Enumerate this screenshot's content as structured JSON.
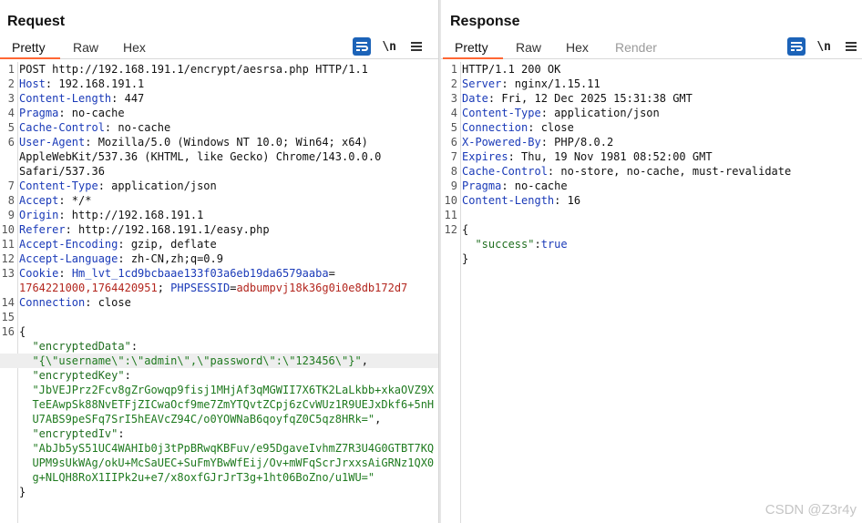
{
  "layout_switch": {
    "options": [
      "split-horizontal",
      "split-vertical",
      "single"
    ],
    "active": "split-horizontal"
  },
  "request": {
    "title": "Request",
    "tabs": [
      {
        "label": "Pretty",
        "active": true
      },
      {
        "label": "Raw"
      },
      {
        "label": "Hex"
      }
    ],
    "tools": {
      "newline_label": "\\n"
    },
    "lines": [
      {
        "n": "1",
        "parts": [
          {
            "t": "POST http://192.168.191.1/encrypt/aesrsa.php HTTP/1.1"
          }
        ]
      },
      {
        "n": "2",
        "parts": [
          {
            "t": "Host",
            "c": "k"
          },
          {
            "t": ": 192.168.191.1"
          }
        ]
      },
      {
        "n": "3",
        "parts": [
          {
            "t": "Content-Length",
            "c": "k"
          },
          {
            "t": ": 447"
          }
        ]
      },
      {
        "n": "4",
        "parts": [
          {
            "t": "Pragma",
            "c": "k"
          },
          {
            "t": ": no-cache"
          }
        ]
      },
      {
        "n": "5",
        "parts": [
          {
            "t": "Cache-Control",
            "c": "k"
          },
          {
            "t": ": no-cache"
          }
        ]
      },
      {
        "n": "6",
        "parts": [
          {
            "t": "User-Agent",
            "c": "k"
          },
          {
            "t": ": Mozilla/5.0 (Windows NT 10.0; Win64; x64)"
          }
        ]
      },
      {
        "n": "",
        "parts": [
          {
            "t": "AppleWebKit/537.36 (KHTML, like Gecko) Chrome/143.0.0.0"
          }
        ]
      },
      {
        "n": "",
        "parts": [
          {
            "t": "Safari/537.36"
          }
        ]
      },
      {
        "n": "7",
        "parts": [
          {
            "t": "Content-Type",
            "c": "k"
          },
          {
            "t": ": application/json"
          }
        ]
      },
      {
        "n": "8",
        "parts": [
          {
            "t": "Accept",
            "c": "k"
          },
          {
            "t": ": */*"
          }
        ]
      },
      {
        "n": "9",
        "parts": [
          {
            "t": "Origin",
            "c": "k"
          },
          {
            "t": ": http://192.168.191.1"
          }
        ]
      },
      {
        "n": "10",
        "parts": [
          {
            "t": "Referer",
            "c": "k"
          },
          {
            "t": ": http://192.168.191.1/easy.php"
          }
        ]
      },
      {
        "n": "11",
        "parts": [
          {
            "t": "Accept-Encoding",
            "c": "k"
          },
          {
            "t": ": gzip, deflate"
          }
        ]
      },
      {
        "n": "12",
        "parts": [
          {
            "t": "Accept-Language",
            "c": "k"
          },
          {
            "t": ": zh-CN,zh;q=0.9"
          }
        ]
      },
      {
        "n": "13",
        "parts": [
          {
            "t": "Cookie",
            "c": "k"
          },
          {
            "t": ": "
          },
          {
            "t": "Hm_lvt_1cd9bcbaae133f03a6eb19da6579aaba",
            "c": "cookie"
          },
          {
            "t": "="
          }
        ]
      },
      {
        "n": "",
        "parts": [
          {
            "t": "1764221000,1764420951",
            "c": "cval"
          },
          {
            "t": "; "
          },
          {
            "t": "PHPSESSID",
            "c": "cookie"
          },
          {
            "t": "="
          },
          {
            "t": "adbumpvj18k36g0i0e8db172d7",
            "c": "cval"
          }
        ]
      },
      {
        "n": "14",
        "parts": [
          {
            "t": "Connection",
            "c": "k"
          },
          {
            "t": ": close"
          }
        ]
      },
      {
        "n": "15",
        "parts": [
          {
            "t": ""
          }
        ]
      },
      {
        "n": "16",
        "parts": [
          {
            "t": "{"
          }
        ]
      },
      {
        "n": "",
        "parts": [
          {
            "t": "  \"encryptedData\"",
            "c": "jkey"
          },
          {
            "t": ":"
          }
        ]
      },
      {
        "n": "",
        "hl": true,
        "parts": [
          {
            "t": "  \"{\\\"username\\\":\\\"admin\\\",\\\"password\\\":\\\"123456\\\"}\"",
            "c": "jstr"
          },
          {
            "t": ","
          }
        ]
      },
      {
        "n": "",
        "parts": [
          {
            "t": "  \"encryptedKey\"",
            "c": "jkey"
          },
          {
            "t": ":"
          }
        ]
      },
      {
        "n": "",
        "parts": [
          {
            "t": "  \"JbVEJPrz2Fcv8gZrGowqp9fisj1MHjAf3qMGWII7X6TK2LaLkbb+xkaOVZ9X",
            "c": "jstr"
          }
        ]
      },
      {
        "n": "",
        "parts": [
          {
            "t": "  TeEAwpSk88NvETFjZICwaOcf9me7ZmYTQvtZCpj6zCvWUz1R9UEJxDkf6+5nH",
            "c": "jstr"
          }
        ]
      },
      {
        "n": "",
        "parts": [
          {
            "t": "  U7ABS9peSFq7SrI5hEAVcZ94C/o0YOWNaB6qoyfqZ0C5qz8HRk=\"",
            "c": "jstr"
          },
          {
            "t": ","
          }
        ]
      },
      {
        "n": "",
        "parts": [
          {
            "t": "  \"encryptedIv\"",
            "c": "jkey"
          },
          {
            "t": ":"
          }
        ]
      },
      {
        "n": "",
        "parts": [
          {
            "t": "  \"AbJb5yS51UC4WAHIb0j3tPpBRwqKBFuv/e95DgaveIvhmZ7R3U4G0GTBT7KQ",
            "c": "jstr"
          }
        ]
      },
      {
        "n": "",
        "parts": [
          {
            "t": "  UPM9sUkWAg/okU+McSaUEC+SuFmYBwWfEij/Ov+mWFqScrJrxxsAiGRNz1QX0",
            "c": "jstr"
          }
        ]
      },
      {
        "n": "",
        "parts": [
          {
            "t": "  g+NLQH8RoX1IIPk2u+e7/x8oxfGJrJrT3g+1ht06BoZno/u1WU=\"",
            "c": "jstr"
          }
        ]
      },
      {
        "n": "",
        "parts": [
          {
            "t": "}"
          }
        ]
      }
    ]
  },
  "response": {
    "title": "Response",
    "tabs": [
      {
        "label": "Pretty",
        "active": true
      },
      {
        "label": "Raw"
      },
      {
        "label": "Hex"
      },
      {
        "label": "Render",
        "disabled": true
      }
    ],
    "tools": {
      "newline_label": "\\n"
    },
    "lines": [
      {
        "n": "1",
        "parts": [
          {
            "t": "HTTP/1.1 200 OK"
          }
        ]
      },
      {
        "n": "2",
        "parts": [
          {
            "t": "Server",
            "c": "k"
          },
          {
            "t": ": nginx/1.15.11"
          }
        ]
      },
      {
        "n": "3",
        "parts": [
          {
            "t": "Date",
            "c": "k"
          },
          {
            "t": ": Fri, 12 Dec 2025 15:31:38 GMT"
          }
        ]
      },
      {
        "n": "4",
        "parts": [
          {
            "t": "Content-Type",
            "c": "k"
          },
          {
            "t": ": application/json"
          }
        ]
      },
      {
        "n": "5",
        "parts": [
          {
            "t": "Connection",
            "c": "k"
          },
          {
            "t": ": close"
          }
        ]
      },
      {
        "n": "6",
        "parts": [
          {
            "t": "X-Powered-By",
            "c": "k"
          },
          {
            "t": ": PHP/8.0.2"
          }
        ]
      },
      {
        "n": "7",
        "parts": [
          {
            "t": "Expires",
            "c": "k"
          },
          {
            "t": ": Thu, 19 Nov 1981 08:52:00 GMT"
          }
        ]
      },
      {
        "n": "8",
        "parts": [
          {
            "t": "Cache-Control",
            "c": "k"
          },
          {
            "t": ": no-store, no-cache, must-revalidate"
          }
        ]
      },
      {
        "n": "9",
        "parts": [
          {
            "t": "Pragma",
            "c": "k"
          },
          {
            "t": ": no-cache"
          }
        ]
      },
      {
        "n": "10",
        "parts": [
          {
            "t": "Content-Length",
            "c": "k"
          },
          {
            "t": ": 16"
          }
        ]
      },
      {
        "n": "11",
        "parts": [
          {
            "t": ""
          }
        ]
      },
      {
        "n": "12",
        "parts": [
          {
            "t": "{"
          }
        ]
      },
      {
        "n": "",
        "parts": [
          {
            "t": "  \"success\"",
            "c": "jkey"
          },
          {
            "t": ":"
          },
          {
            "t": "true",
            "c": "jtrue"
          }
        ]
      },
      {
        "n": "",
        "parts": [
          {
            "t": "}"
          }
        ]
      }
    ]
  },
  "watermark": "CSDN @Z3r4y",
  "colors": {
    "accent": "#1c63b8",
    "tab_underline": "#ff6633",
    "header_key": "#1a3ab8",
    "cookie_value": "#b3261e",
    "json_string": "#1f7a1f"
  }
}
